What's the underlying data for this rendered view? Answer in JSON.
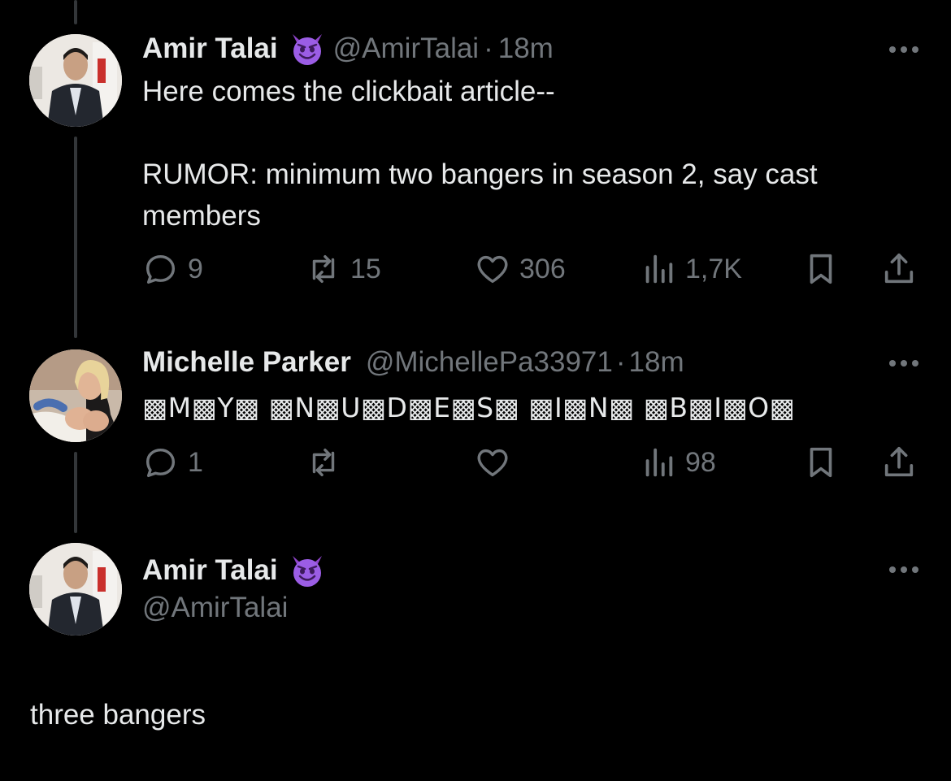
{
  "tweets": [
    {
      "name": "Amir Talai",
      "handle": "@AmirTalai",
      "separator": "·",
      "time": "18m",
      "text": "Here comes the clickbait article--\n\nRUMOR: minimum two bangers in season 2, say cast members",
      "actions": {
        "replies": "9",
        "retweets": "15",
        "likes": "306",
        "views": "1,7K"
      }
    },
    {
      "name": "Michelle Parker",
      "handle": "@MichellePa33971",
      "separator": "·",
      "time": "18m",
      "text": "▩M▩Y▩ ▩N▩U▩D▩E▩S▩ ▩I▩N▩ ▩B▩I▩O▩",
      "actions": {
        "replies": "1",
        "retweets": "",
        "likes": "",
        "views": "98"
      }
    },
    {
      "name": "Amir Talai",
      "handle": "@AmirTalai",
      "text": "three bangers"
    }
  ],
  "icons": {
    "reply": "speech-bubble-icon",
    "retweet": "retweet-arrows-icon",
    "like": "heart-icon",
    "views": "bar-chart-icon",
    "bookmark": "bookmark-icon",
    "share": "share-upload-icon",
    "emoji": "smiling-imp-emoji",
    "more": "more-dots-icon"
  },
  "colors": {
    "background": "#000000",
    "text": "#e7e9ea",
    "muted": "#71767b",
    "emoji": "#9b5de5"
  }
}
